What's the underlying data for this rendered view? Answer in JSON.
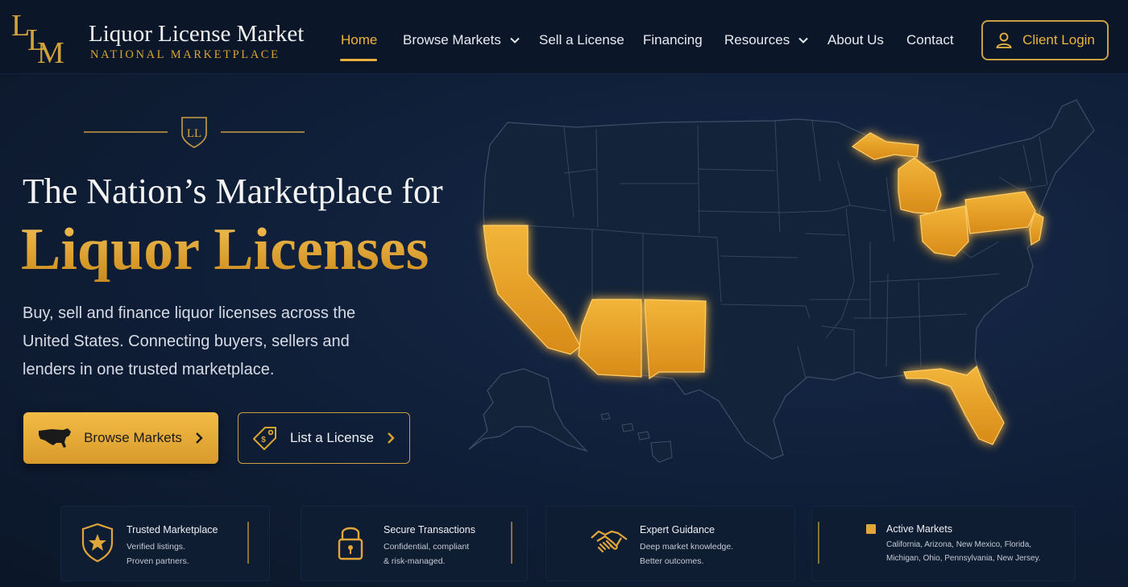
{
  "brand": {
    "monogram": "LLM",
    "title": "Liquor License Market",
    "subtitle": "NATIONAL MARKETPLACE"
  },
  "nav": {
    "items": [
      {
        "label": "Home",
        "active": true,
        "dropdown": false
      },
      {
        "label": "Browse Markets",
        "active": false,
        "dropdown": true
      },
      {
        "label": "Sell a License",
        "active": false,
        "dropdown": false
      },
      {
        "label": "Financing",
        "active": false,
        "dropdown": false
      },
      {
        "label": "Resources",
        "active": false,
        "dropdown": true
      },
      {
        "label": "About Us",
        "active": false,
        "dropdown": false
      },
      {
        "label": "Contact",
        "active": false,
        "dropdown": false
      }
    ],
    "login_label": "Client Login"
  },
  "hero": {
    "crest_monogram": "LL",
    "title_line1": "The Nation’s Marketplace for",
    "title_line2": "Liquor Licenses",
    "description": "Buy, sell and finance liquor licenses across the United States. Connecting buyers, sellers and lenders in one trusted marketplace.",
    "primary_button": "Browse Markets",
    "secondary_button": "List a License"
  },
  "map": {
    "highlight_color": "#e8a22a",
    "base_color": "#13233c",
    "highlighted_states": [
      "California",
      "Arizona",
      "New Mexico",
      "Florida",
      "Michigan",
      "Ohio",
      "Pennsylvania",
      "New Jersey"
    ]
  },
  "features": [
    {
      "title": "Trusted Marketplace",
      "line1": "Verified listings.",
      "line2": "Proven partners.",
      "icon": "shield-star-icon"
    },
    {
      "title": "Secure Transactions",
      "line1": "Confidential, compliant",
      "line2": "& risk-managed.",
      "icon": "padlock-icon"
    },
    {
      "title": "Expert Guidance",
      "line1": "Deep market knowledge.",
      "line2": "Better outcomes.",
      "icon": "handshake-icon"
    }
  ],
  "active_markets": {
    "title": "Active Markets",
    "text": "California, Arizona, New Mexico, Florida, Michigan, Ohio, Pennsylvania, New Jersey."
  },
  "colors": {
    "accent": "#e0a530",
    "background": "#10203a",
    "header": "#0b1729"
  }
}
